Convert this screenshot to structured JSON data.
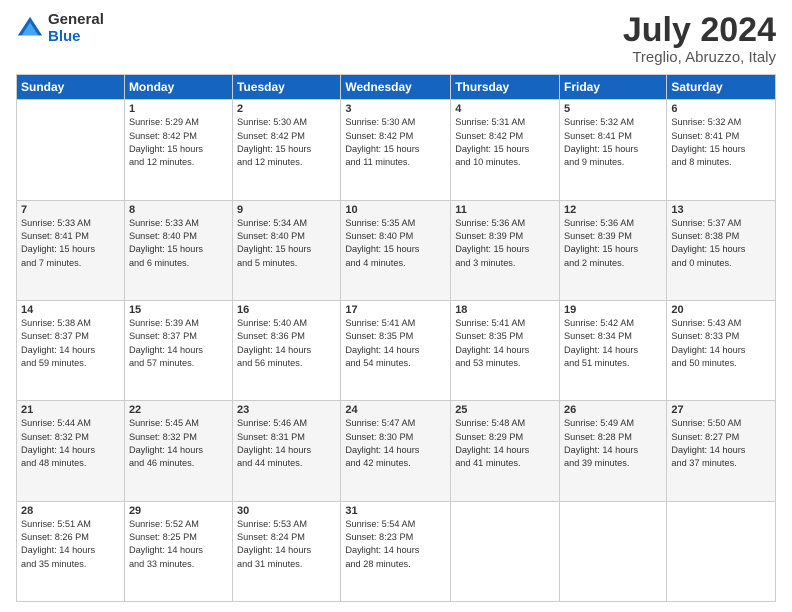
{
  "logo": {
    "general": "General",
    "blue": "Blue"
  },
  "title": "July 2024",
  "subtitle": "Treglio, Abruzzo, Italy",
  "days_of_week": [
    "Sunday",
    "Monday",
    "Tuesday",
    "Wednesday",
    "Thursday",
    "Friday",
    "Saturday"
  ],
  "weeks": [
    [
      {
        "day": "",
        "info": ""
      },
      {
        "day": "1",
        "info": "Sunrise: 5:29 AM\nSunset: 8:42 PM\nDaylight: 15 hours\nand 12 minutes."
      },
      {
        "day": "2",
        "info": "Sunrise: 5:30 AM\nSunset: 8:42 PM\nDaylight: 15 hours\nand 12 minutes."
      },
      {
        "day": "3",
        "info": "Sunrise: 5:30 AM\nSunset: 8:42 PM\nDaylight: 15 hours\nand 11 minutes."
      },
      {
        "day": "4",
        "info": "Sunrise: 5:31 AM\nSunset: 8:42 PM\nDaylight: 15 hours\nand 10 minutes."
      },
      {
        "day": "5",
        "info": "Sunrise: 5:32 AM\nSunset: 8:41 PM\nDaylight: 15 hours\nand 9 minutes."
      },
      {
        "day": "6",
        "info": "Sunrise: 5:32 AM\nSunset: 8:41 PM\nDaylight: 15 hours\nand 8 minutes."
      }
    ],
    [
      {
        "day": "7",
        "info": "Sunrise: 5:33 AM\nSunset: 8:41 PM\nDaylight: 15 hours\nand 7 minutes."
      },
      {
        "day": "8",
        "info": "Sunrise: 5:33 AM\nSunset: 8:40 PM\nDaylight: 15 hours\nand 6 minutes."
      },
      {
        "day": "9",
        "info": "Sunrise: 5:34 AM\nSunset: 8:40 PM\nDaylight: 15 hours\nand 5 minutes."
      },
      {
        "day": "10",
        "info": "Sunrise: 5:35 AM\nSunset: 8:40 PM\nDaylight: 15 hours\nand 4 minutes."
      },
      {
        "day": "11",
        "info": "Sunrise: 5:36 AM\nSunset: 8:39 PM\nDaylight: 15 hours\nand 3 minutes."
      },
      {
        "day": "12",
        "info": "Sunrise: 5:36 AM\nSunset: 8:39 PM\nDaylight: 15 hours\nand 2 minutes."
      },
      {
        "day": "13",
        "info": "Sunrise: 5:37 AM\nSunset: 8:38 PM\nDaylight: 15 hours\nand 0 minutes."
      }
    ],
    [
      {
        "day": "14",
        "info": "Sunrise: 5:38 AM\nSunset: 8:37 PM\nDaylight: 14 hours\nand 59 minutes."
      },
      {
        "day": "15",
        "info": "Sunrise: 5:39 AM\nSunset: 8:37 PM\nDaylight: 14 hours\nand 57 minutes."
      },
      {
        "day": "16",
        "info": "Sunrise: 5:40 AM\nSunset: 8:36 PM\nDaylight: 14 hours\nand 56 minutes."
      },
      {
        "day": "17",
        "info": "Sunrise: 5:41 AM\nSunset: 8:35 PM\nDaylight: 14 hours\nand 54 minutes."
      },
      {
        "day": "18",
        "info": "Sunrise: 5:41 AM\nSunset: 8:35 PM\nDaylight: 14 hours\nand 53 minutes."
      },
      {
        "day": "19",
        "info": "Sunrise: 5:42 AM\nSunset: 8:34 PM\nDaylight: 14 hours\nand 51 minutes."
      },
      {
        "day": "20",
        "info": "Sunrise: 5:43 AM\nSunset: 8:33 PM\nDaylight: 14 hours\nand 50 minutes."
      }
    ],
    [
      {
        "day": "21",
        "info": "Sunrise: 5:44 AM\nSunset: 8:32 PM\nDaylight: 14 hours\nand 48 minutes."
      },
      {
        "day": "22",
        "info": "Sunrise: 5:45 AM\nSunset: 8:32 PM\nDaylight: 14 hours\nand 46 minutes."
      },
      {
        "day": "23",
        "info": "Sunrise: 5:46 AM\nSunset: 8:31 PM\nDaylight: 14 hours\nand 44 minutes."
      },
      {
        "day": "24",
        "info": "Sunrise: 5:47 AM\nSunset: 8:30 PM\nDaylight: 14 hours\nand 42 minutes."
      },
      {
        "day": "25",
        "info": "Sunrise: 5:48 AM\nSunset: 8:29 PM\nDaylight: 14 hours\nand 41 minutes."
      },
      {
        "day": "26",
        "info": "Sunrise: 5:49 AM\nSunset: 8:28 PM\nDaylight: 14 hours\nand 39 minutes."
      },
      {
        "day": "27",
        "info": "Sunrise: 5:50 AM\nSunset: 8:27 PM\nDaylight: 14 hours\nand 37 minutes."
      }
    ],
    [
      {
        "day": "28",
        "info": "Sunrise: 5:51 AM\nSunset: 8:26 PM\nDaylight: 14 hours\nand 35 minutes."
      },
      {
        "day": "29",
        "info": "Sunrise: 5:52 AM\nSunset: 8:25 PM\nDaylight: 14 hours\nand 33 minutes."
      },
      {
        "day": "30",
        "info": "Sunrise: 5:53 AM\nSunset: 8:24 PM\nDaylight: 14 hours\nand 31 minutes."
      },
      {
        "day": "31",
        "info": "Sunrise: 5:54 AM\nSunset: 8:23 PM\nDaylight: 14 hours\nand 28 minutes."
      },
      {
        "day": "",
        "info": ""
      },
      {
        "day": "",
        "info": ""
      },
      {
        "day": "",
        "info": ""
      }
    ]
  ]
}
